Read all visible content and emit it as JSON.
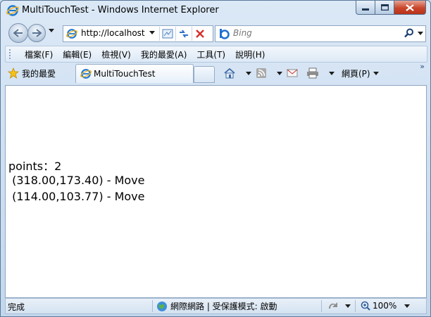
{
  "window": {
    "title": "MultiTouchTest - Windows Internet Explorer"
  },
  "nav": {
    "address_url": "http://localhost",
    "search_placeholder": "Bing"
  },
  "menu": {
    "items": [
      "檔案(F)",
      "編輯(E)",
      "檢視(V)",
      "我的最愛(A)",
      "工具(T)",
      "說明(H)"
    ]
  },
  "tabs": {
    "favorites_label": "我的最愛",
    "active_tab_title": "MultiTouchTest",
    "page_menu_label": "網頁(P)"
  },
  "content": {
    "lines": [
      "points：2",
      " (318.00,173.40) - Move",
      " (114.00,103.77) - Move"
    ]
  },
  "status": {
    "text": "完成",
    "zone": "網際網路 | 受保護模式: 啟動",
    "zoom": "100%"
  },
  "colors": {
    "close_button": "#c9452a",
    "chrome_bg": "#c9dcef"
  },
  "icons": [
    "ie-icon",
    "back-icon",
    "forward-icon",
    "dropdown-icon",
    "compat-view-icon",
    "refresh-icon",
    "stop-icon",
    "bing-icon",
    "search-icon",
    "star-icon",
    "home-icon",
    "feeds-icon",
    "mail-icon",
    "print-icon",
    "globe-icon",
    "zoom-icon"
  ]
}
